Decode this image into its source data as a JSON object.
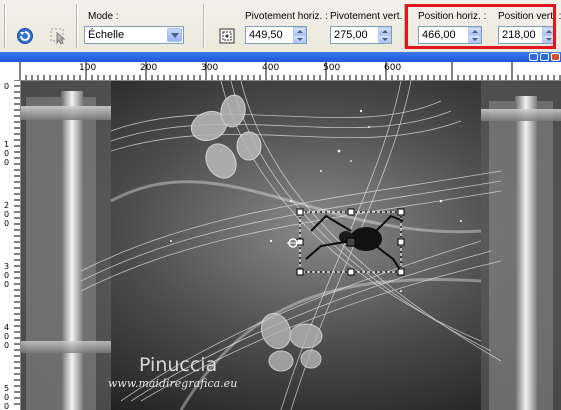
{
  "toolbar": {
    "mode_label": "Mode :",
    "mode_value": "Échelle",
    "pivot_h_label": "Pivotement horiz. :",
    "pivot_h_value": "449,50",
    "pivot_v_label": "Pivotement vert. :",
    "pivot_v_value": "275,00",
    "pos_h_label": "Position horiz. :",
    "pos_h_value": "466,00",
    "pos_v_label": "Position vert. :",
    "pos_v_value": "218,00",
    "highlight_color": "#e0161f"
  },
  "document": {
    "title": "",
    "ruler_h": [
      "100",
      "200",
      "300",
      "400",
      "500",
      "600"
    ],
    "ruler_v": [
      "0",
      "100",
      "200",
      "300",
      "400",
      "500"
    ]
  },
  "canvas": {
    "watermark": "Pinuccia",
    "watermark_url": "www.maidiregrafica.eu"
  },
  "icons": [
    "undo-icon",
    "select-tool-icon",
    "pick-tool-icon",
    "reset-icon"
  ]
}
